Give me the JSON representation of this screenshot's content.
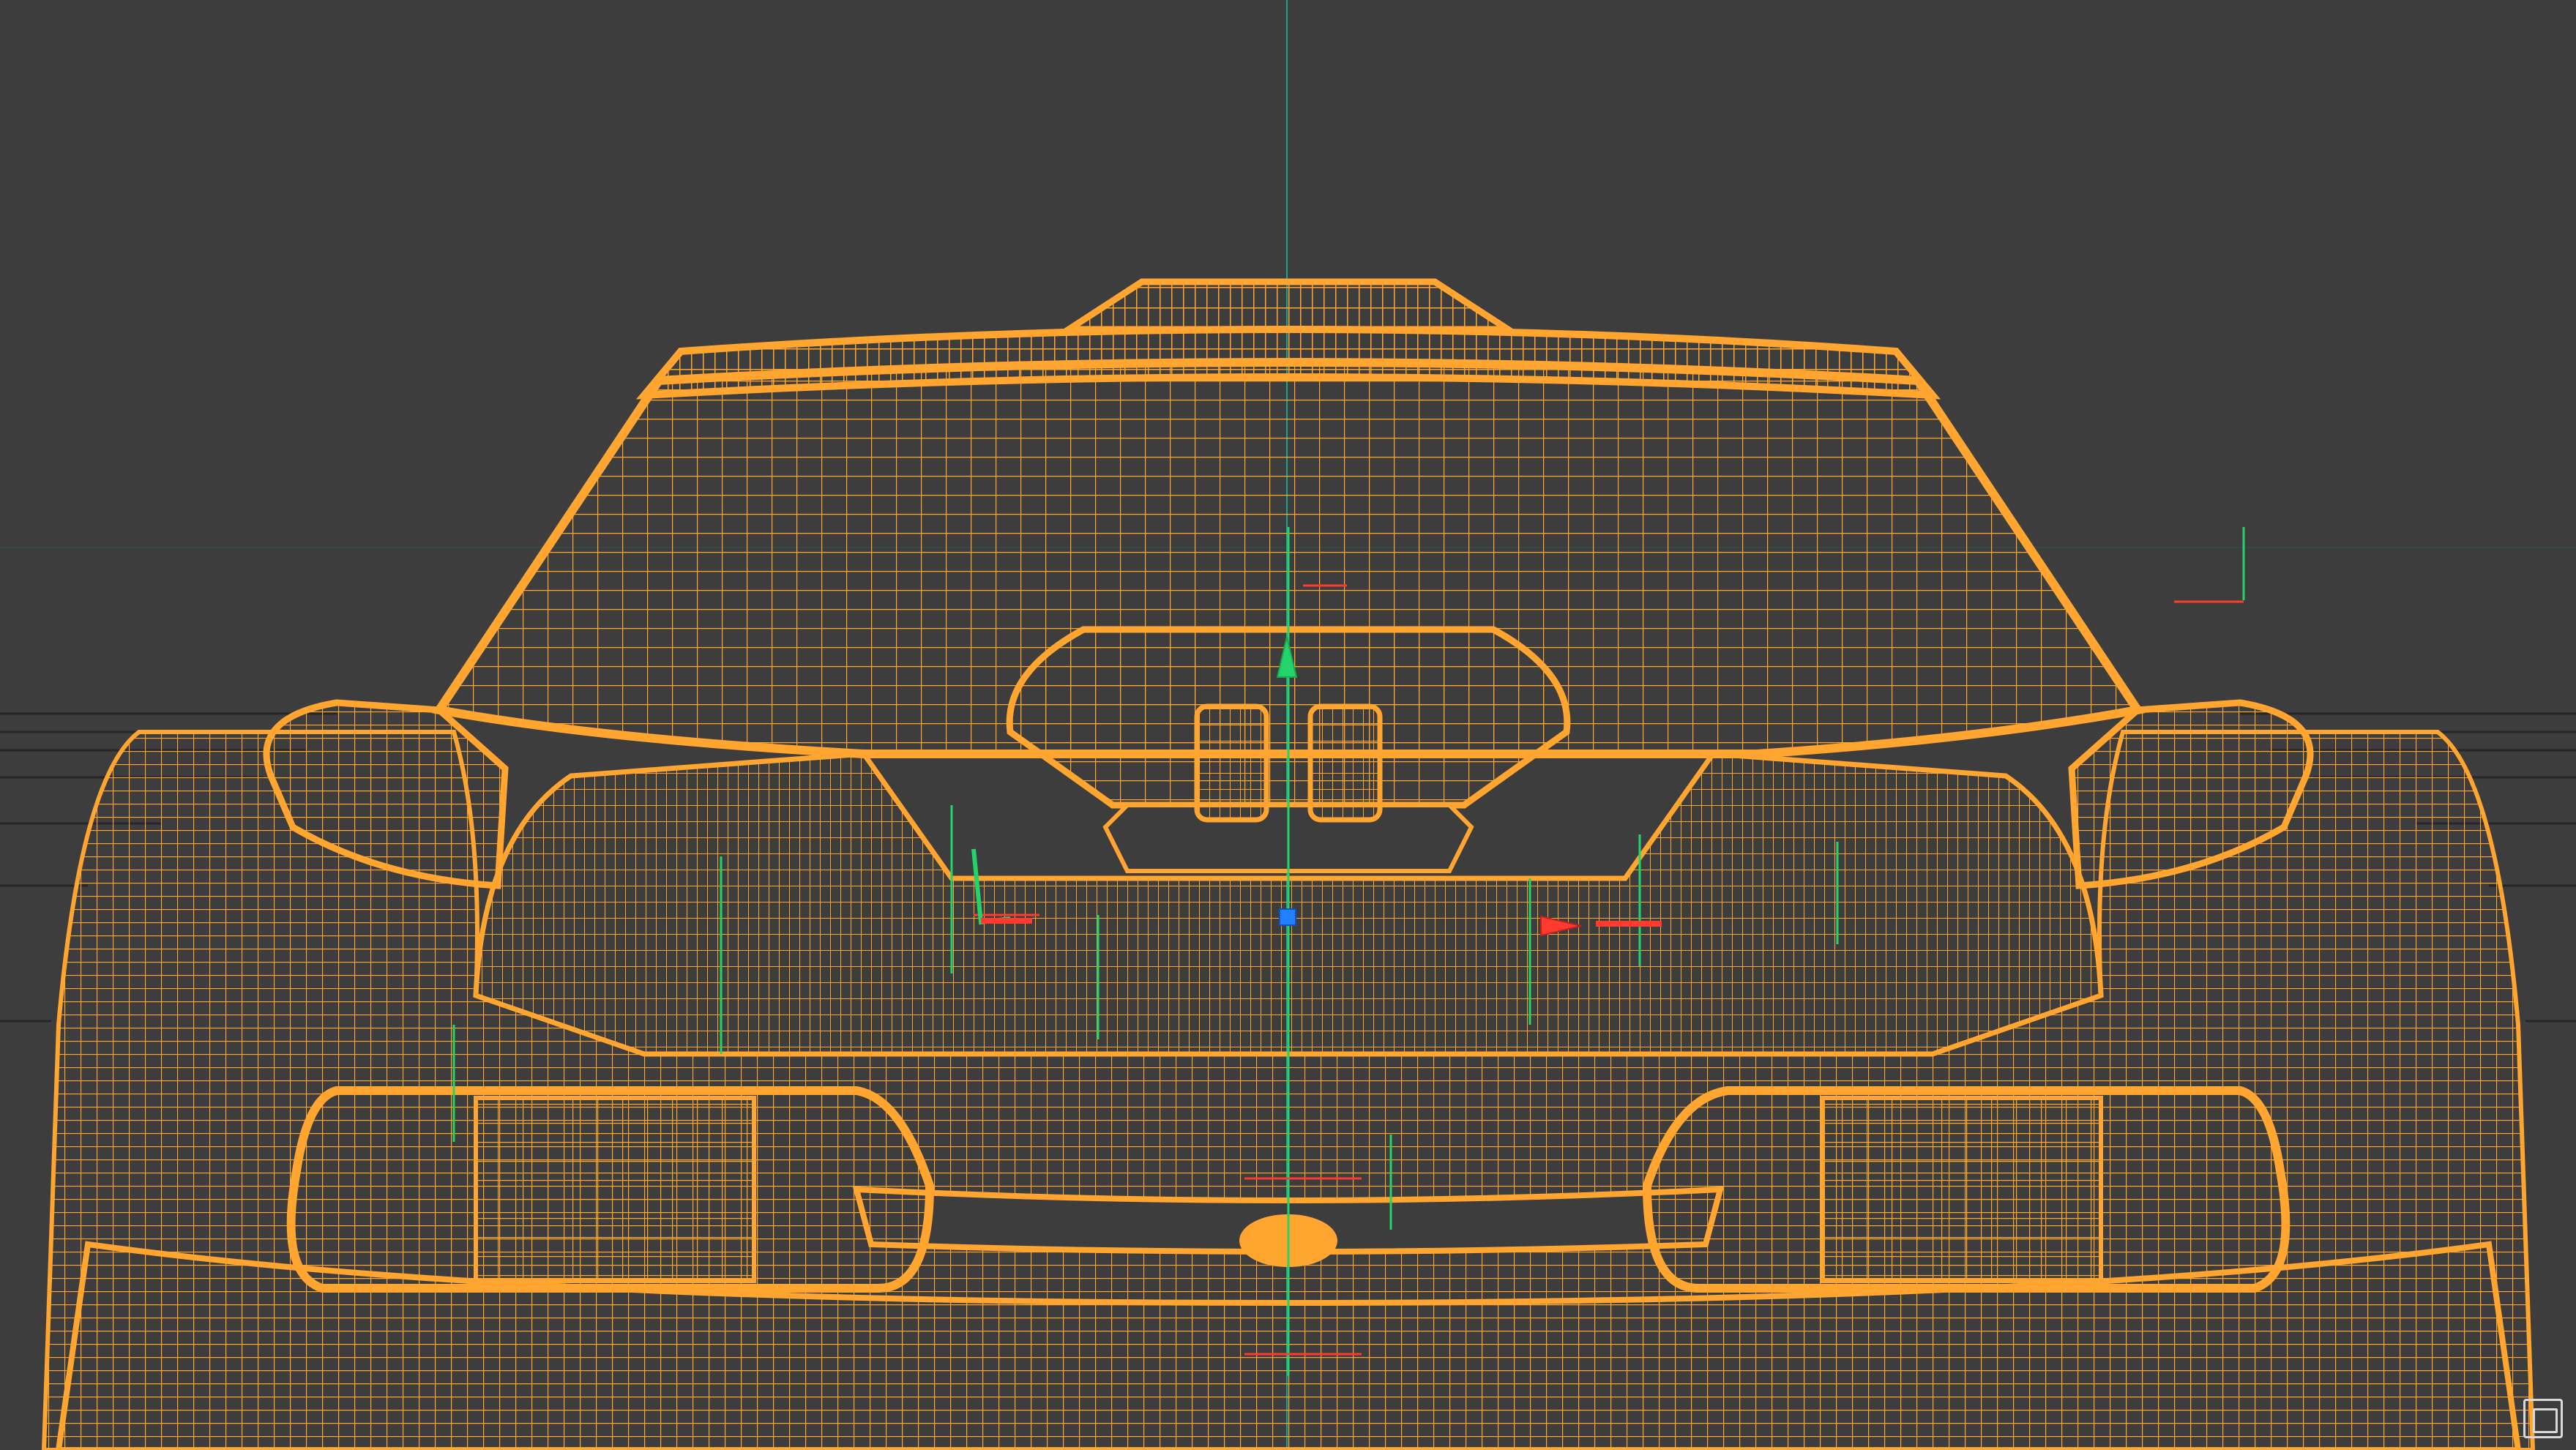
{
  "viewport": {
    "mode": "wireframe",
    "background_color": "#3d3d3d",
    "wire_color": "#ffa530",
    "object": "car-front-mesh",
    "selected": true,
    "gizmo": {
      "type": "move",
      "x_axis_color": "#ff3b30",
      "y_axis_color": "#22d46a",
      "z_axis_color": "#2080ff"
    },
    "grid_color": "#2a2a2a"
  },
  "corner_widget": {
    "icon": "viewport-options-icon"
  }
}
